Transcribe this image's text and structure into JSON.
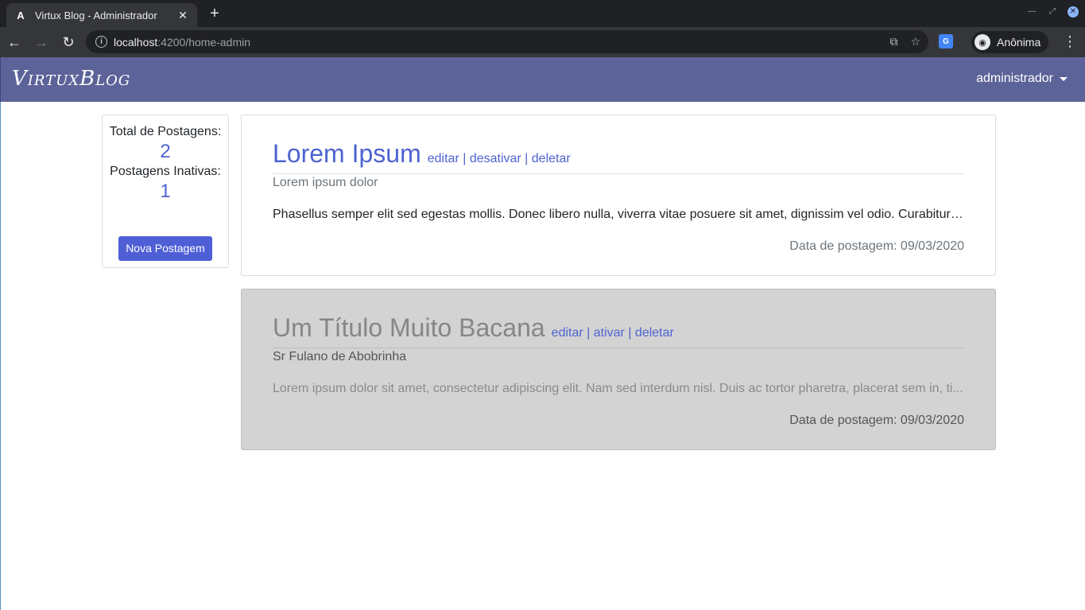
{
  "browser": {
    "tab_title": "Virtux Blog - Administrador",
    "tab_favicon": "A",
    "new_tab": "+",
    "url_host": "localhost",
    "url_path": ":4200/home-admin",
    "incognito_label": "Anônima"
  },
  "navbar": {
    "brand": "VirtuxBlog",
    "user": "administrador"
  },
  "stats": {
    "total_label": "Total de Postagens:",
    "total_value": "2",
    "inactive_label": "Postagens Inativas:",
    "inactive_value": "1",
    "new_post_button": "Nova Postagem"
  },
  "posts": [
    {
      "title": "Lorem Ipsum",
      "edit": "editar",
      "toggle": "desativar",
      "delete": "deletar",
      "sep": " | ",
      "subtitle": "Lorem ipsum dolor",
      "body": "Phasellus semper elit sed egestas mollis. Donec libero nulla, viverra vitae posuere sit amet, dignissim vel odio. Curabitur ...",
      "date": "Data de postagem: 09/03/2020",
      "active": true
    },
    {
      "title": "Um Título Muito Bacana",
      "edit": "editar",
      "toggle": "ativar",
      "delete": "deletar",
      "sep": " | ",
      "subtitle": "Sr Fulano de Abobrinha",
      "body": "Lorem ipsum dolor sit amet, consectetur adipiscing elit. Nam sed interdum nisl. Duis ac tortor pharetra, placerat sem in, ti...",
      "date": "Data de postagem: 09/03/2020",
      "active": false
    }
  ],
  "colors": {
    "navbar_bg": "#5c6399",
    "accent": "#4e63d0",
    "inactive_bg": "#d3d3d3"
  }
}
